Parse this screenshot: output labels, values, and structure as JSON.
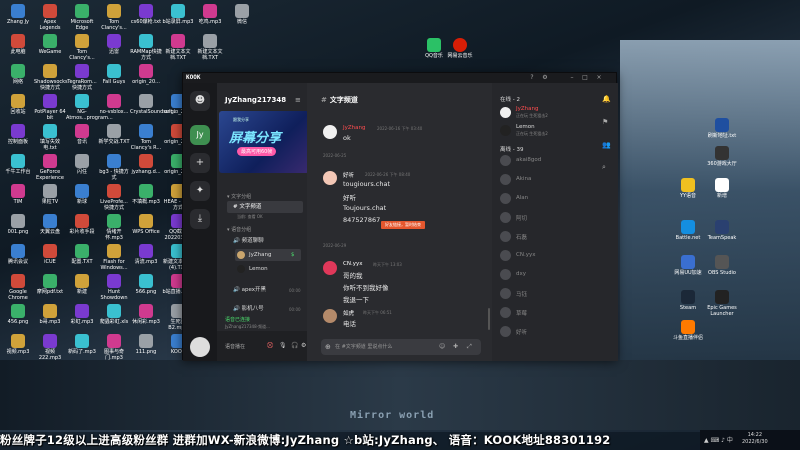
{
  "desktop": {
    "icons_left": [
      [
        "Zhang Jy",
        "Apex Legends",
        "Microsoft Edge",
        "Tom Clancy's...",
        "cs60爆枪.txt",
        "b站录屏.mp3",
        "吃鸡.mp3",
        "微信"
      ],
      [
        "此电脑",
        "WeGame",
        "Tom Clancy's...",
        "迅雷",
        "RAMMap快捷方式",
        "新建文本文档.TXT",
        "新建文本文档.TXT"
      ],
      [
        "网络",
        "Shadowsocks快捷方式",
        "TegraRom...快捷方式",
        "Fall Guys",
        "origin_20..."
      ],
      [
        "回收站",
        "PotPlayer 64 bit",
        "NG-Atmos...program...",
        "no-vsblox...",
        "CrystalSoundsuit...",
        "origin_20..."
      ],
      [
        "控制面板",
        "填写失效电.txt",
        "音讯",
        "新学交战.TXT",
        "Tom Clancy's R...",
        "origin_20..."
      ],
      [
        "千牛工作台",
        "GeForce Experience",
        "闪任",
        "bg3 - 快捷方式",
        "jyzhang.d...",
        "origin_20..."
      ],
      [
        "TIM",
        "果粒TV",
        "新球",
        "LiveProfe...快捷方式",
        "不填概.mp3",
        "HEAE - 快捷方式"
      ],
      [
        "001.png",
        "天翼云盘",
        "彩片收手段",
        "情绪开怀.mp3",
        "WPS Office",
        "QQ截图2022031..."
      ],
      [
        "腾讯会议",
        "iCUE",
        "配置.TXT",
        "Flash for Windows...",
        "清流.mp3",
        "新建文本文档(4).TXT"
      ],
      [
        "Google Chrome",
        "摩网pdf.txt",
        "新建",
        "Hunt Showdown",
        "566.png",
        "b站直播.mp3"
      ],
      [
        "456.png",
        "b哥.mp3",
        "彩虹.mp3",
        "爬蟲彩虹.xls",
        "休闲彩.mp3",
        "生死团B2.mp3"
      ],
      [
        "视频.mp3",
        "视频222.mp3",
        "新码了.mp3",
        "图事与奇门.mp3",
        "111.png",
        "KOOK"
      ]
    ],
    "icons_top": [
      "QQ音乐",
      "网易云音乐"
    ],
    "icons_right": [
      "刷新地址.txt",
      "360游戏大厅",
      "YY语音",
      "Battle.net",
      "网易UU加速",
      "Steam",
      "斗鱼直播伴侣",
      "TeamSpeak",
      "新增",
      "OBS Studio",
      "Epic Games Launcher"
    ],
    "mirror_text": "Mirror world",
    "ticker": "粉丝牌子12级以上进高级粉丝群 进群加WX-新浪微博:JyZhang ☆b站:JyZhang、 语音：KOOK地址88301192",
    "clock_time": "14:22",
    "clock_date": "2022/6/30"
  },
  "kook": {
    "logo": "KOOK",
    "server_name": "JyZhang217348",
    "banner": {
      "line1": "跟我分享",
      "title": "屏幕分享",
      "tag": "最高可用60帧"
    },
    "groups": {
      "text": "文字分组",
      "voice": "语音分组"
    },
    "text_channel": "文字频道",
    "text_channel_sub": "当前: 查看 OK",
    "voice_channels": [
      {
        "name": "频道聊聊",
        "time": ""
      },
      {
        "name": "apex开黑",
        "time": "00:00"
      },
      {
        "name": "影机八号",
        "time": "00:00"
      }
    ],
    "voice_users": [
      {
        "name": "JyZhang",
        "badge": "$"
      },
      {
        "name": "Lemon",
        "badge": ""
      }
    ],
    "voice_status": "语音已连接",
    "voice_status_sub": "JyZhang217348-频道...",
    "user_text": "语音播在",
    "chat": {
      "title": "文字频道",
      "messages": [
        {
          "name": "JyZhang",
          "time": "2022-06-16 下午 03:40",
          "lines": [
            "ok"
          ],
          "red": true
        },
        {
          "name": "好听",
          "time": "2022-06-26 下午 08:40",
          "lines": [
            "tougiours.chat",
            "好听",
            "Toujours.chat",
            "847527867"
          ],
          "red": false
        },
        {
          "name": "CN.yyx",
          "time": "昨天下午 13:03",
          "lines": [
            "哥的我",
            "你听不到我好像",
            "我退一下"
          ],
          "red": false
        },
        {
          "name": "如虎",
          "time": "昨天下午 06:51",
          "lines": [
            "电话"
          ],
          "red": false
        }
      ],
      "date_1": "2022-06-25",
      "date_2": "2022-06-29",
      "badge": "好友链接，暂时结束",
      "input_placeholder": "在 #文字频道 里说点什么"
    },
    "members": {
      "online_label": "在线 - 2",
      "offline_label": "离线 - 39",
      "online": [
        {
          "name": "JyZhang",
          "sub": "正在玩 生死狙击2"
        },
        {
          "name": "Lemon",
          "sub": "正在玩 生死狙击2"
        }
      ],
      "offline": [
        "akai8god",
        "Akina",
        "Alan",
        "阿切",
        "石磊",
        "CN.yyx",
        "dxy",
        "马钰",
        "草莓",
        "好听"
      ]
    }
  }
}
